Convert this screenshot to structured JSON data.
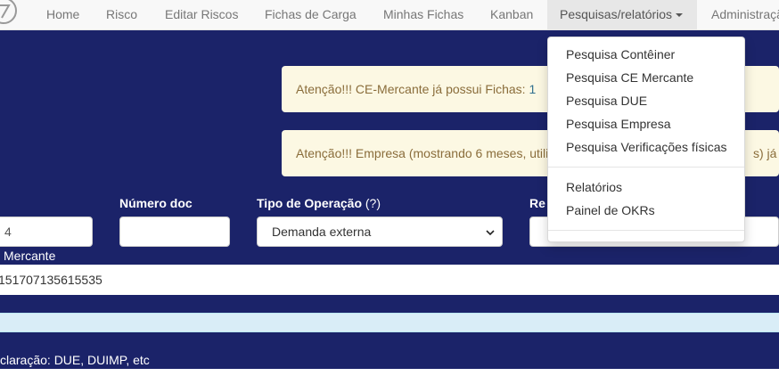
{
  "navbar": {
    "logo_icon": "brand-logo-icon",
    "items": [
      {
        "label": "Home"
      },
      {
        "label": "Risco"
      },
      {
        "label": "Editar Riscos"
      },
      {
        "label": "Fichas de Carga"
      },
      {
        "label": "Minhas Fichas"
      },
      {
        "label": "Kanban"
      },
      {
        "label": "Pesquisas/relatórios"
      },
      {
        "label": "Administraçã"
      }
    ]
  },
  "dropdown": {
    "items": [
      {
        "label": "Pesquisa Contêiner"
      },
      {
        "label": "Pesquisa CE Mercante"
      },
      {
        "label": "Pesquisa DUE"
      },
      {
        "label": "Pesquisa Empresa"
      },
      {
        "label": "Pesquisa Verificações físicas"
      },
      {
        "label": "Relatórios"
      },
      {
        "label": "Painel de OKRs"
      }
    ]
  },
  "alerts": {
    "ce_mercante_text": "Atenção!!! CE-Mercante já possui Fichas: ",
    "ce_mercante_link": "1",
    "empresa_text": "Atenção!!! Empresa (mostrando 6 meses, utili",
    "empresa_tail": "s) já po"
  },
  "form": {
    "first_input_value": "4",
    "numero_doc_label": "Número doc",
    "numero_doc_value": "",
    "tipo_operacao_label": "Tipo de Operação",
    "tipo_operacao_help": "(?)",
    "tipo_operacao_value": "Demanda externa",
    "req_label_partial": "Re",
    "ce_mercante_label": "Mercante",
    "ce_mercante_value": "151707135615535",
    "declaracao_label": "claração: DUE, DUIMP, etc"
  },
  "colors": {
    "page_bg": "#1b2369",
    "navbar_bg": "#f8f8f8",
    "alert_bg": "#fcf8e3",
    "alert_text": "#8a6d3b",
    "info_bar_bg": "#d9edf7"
  }
}
